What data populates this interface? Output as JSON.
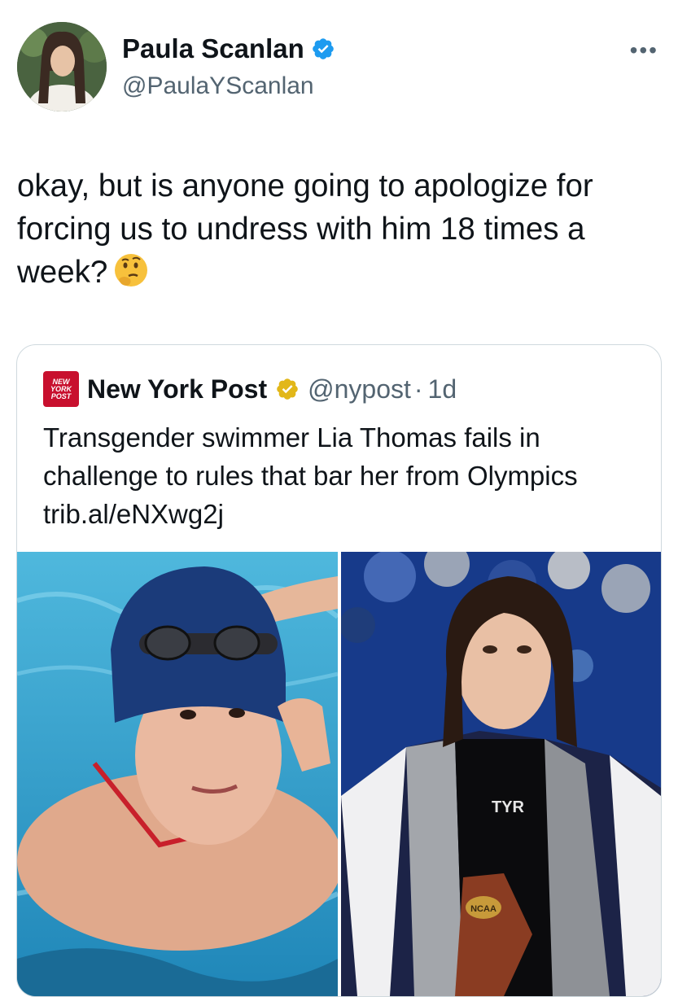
{
  "author": {
    "display_name": "Paula Scanlan",
    "handle": "@PaulaYScanlan",
    "verified": true,
    "verified_badge_color": "#1d9bf0"
  },
  "tweet": {
    "text": "okay, but is anyone going to apologize for forcing us to undress with him 18 times a week?",
    "emoji": "thinking-face"
  },
  "menu": {
    "more_label": "•••"
  },
  "quoted": {
    "display_name": "New York Post",
    "handle": "@nypost",
    "separator": "·",
    "time": "1d",
    "verified_badge_color": "#e2b719",
    "logo_lines": [
      "NEW",
      "YORK",
      "POST"
    ],
    "logo_color": "#c8102e",
    "text": "Transgender swimmer Lia Thomas fails in challenge to rules that bar her from Olympics trib.al/eNXwg2j",
    "media": {
      "right_labels": {
        "suit_brand": "TYR",
        "trophy": "NCAA"
      }
    }
  },
  "colors": {
    "text_primary": "#0f1419",
    "text_secondary": "#536471",
    "border": "#cfd9de"
  }
}
